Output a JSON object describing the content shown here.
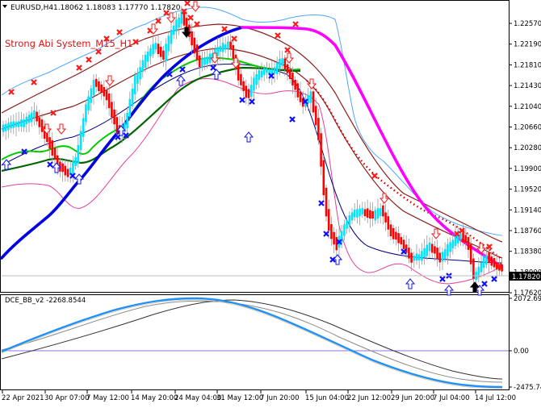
{
  "header": {
    "symbol_label": "EURUSD,H4",
    "ohlc": "1.18062 1.18083 1.17770 1.17820",
    "system_label": "Strong Abi System_M15_H1"
  },
  "price_axis": {
    "ticks": [
      "1.22570",
      "1.22190",
      "1.21810",
      "1.21430",
      "1.21040",
      "1.20660",
      "1.20280",
      "1.19900",
      "1.19520",
      "1.19140",
      "1.18760",
      "1.18380",
      "1.18000",
      "1.17620"
    ],
    "current_price": "1.17820"
  },
  "indicator": {
    "label": "DCE_BB_v2 -2268.8544",
    "ticks": [
      "2072.6936",
      "0.00",
      "-2475.7481"
    ]
  },
  "time_axis": {
    "labels": [
      "22 Apr 2021",
      "30 Apr 07:00",
      "7 May 12:00",
      "14 May 20:00",
      "24 May 04:00",
      "31 May 12:00",
      "7 Jun 20:00",
      "15 Jun 04:00",
      "22 Jun 12:00",
      "29 Jun 20:00",
      "7 Jul 04:00",
      "14 Jul 12:00"
    ]
  },
  "colors": {
    "bull_candle": "#00e5ff",
    "bear_candle": "#ff0000",
    "ma_fast": "#0000ff",
    "ma_slow": "#ff00ff",
    "band_green": "#00cc00",
    "band_darkgreen": "#006400",
    "band_brown": "#8b1a1a",
    "bollinger_outer": "#4da6ff",
    "bollinger_lower": "#e0409a",
    "osc_line": "#1e90ff",
    "osc_zero": "#9370db"
  }
}
